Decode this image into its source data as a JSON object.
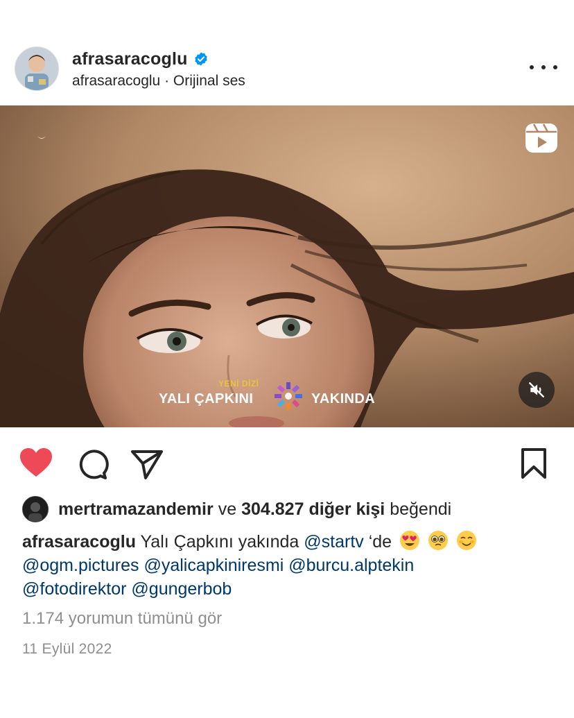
{
  "post": {
    "username": "afrasaracoglu",
    "subtitle": "afrasaracoglu · Orijinal ses",
    "verified": true,
    "more_icon": "more-horizontal-icon"
  },
  "media": {
    "reel_icon": "reels-icon",
    "mute_icon": "speaker-muted-icon",
    "promo_tag": "YENİ DİZİ",
    "promo_title": "YALI ÇAPKINI",
    "promo_soon": "YAKINDA"
  },
  "actions": {
    "like_icon": "heart-filled-icon",
    "comment_icon": "comment-icon",
    "share_icon": "send-icon",
    "save_icon": "bookmark-icon",
    "like_color": "#ed4956"
  },
  "likes": {
    "user": "mertramazandemir",
    "connector": "ve",
    "count": "304.827 diğer kişi",
    "suffix": "beğendi"
  },
  "caption": {
    "author": "afrasaracoglu",
    "text": "Yalı Çapkını yakında",
    "mention1": "@startv",
    "after_mention": "‘de",
    "emojis": [
      "heart-eyes-emoji",
      "pleading-face-emoji",
      "smiling-face-emoji"
    ],
    "mentions_line2": [
      "@ogm.pictures",
      "@yalicapkiniresmi",
      "@burcu.alptekin"
    ],
    "mentions_line3": [
      "@fotodirektor",
      "@gungerbob"
    ]
  },
  "comments_link": "1.174 yorumun tümünü gör",
  "date": "11 Eylül 2022"
}
